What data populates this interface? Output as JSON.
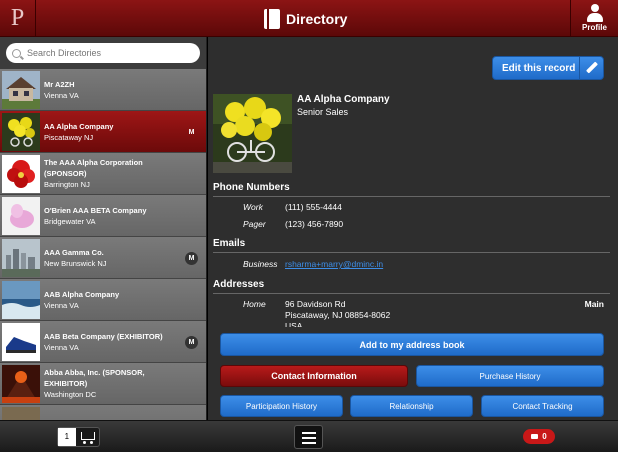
{
  "header": {
    "logo": "P",
    "title": "Directory",
    "title_icon": "address-book-icon",
    "profile_label": "Profile",
    "color": "#7a1010"
  },
  "sidebar": {
    "search_placeholder": "Search Directories",
    "items": [
      {
        "name": "Mr A2ZH",
        "location": "Vienna VA",
        "badge": "",
        "selected": false
      },
      {
        "name": "AA Alpha Company",
        "location": "Piscataway NJ",
        "badge": "M",
        "selected": true
      },
      {
        "name": "The AAA Alpha Corporation (SPONSOR)",
        "location": "Barrington NJ",
        "badge": "",
        "selected": false
      },
      {
        "name": "O'Brien AAA BETA Company",
        "location": "Bridgewater VA",
        "badge": "",
        "selected": false
      },
      {
        "name": "AAA Gamma Co.",
        "location": "New Brunswick NJ",
        "badge": "M",
        "selected": false
      },
      {
        "name": "AAB Alpha Company",
        "location": "Vienna VA",
        "badge": "",
        "selected": false
      },
      {
        "name": "AAB Beta Company (EXHIBITOR)",
        "location": "Vienna VA",
        "badge": "M",
        "selected": false
      },
      {
        "name": "Abba Abba, Inc. (SPONSOR, EXHIBITOR)",
        "location": "Washington DC",
        "badge": "",
        "selected": false
      },
      {
        "name": "",
        "location": "",
        "badge": "",
        "selected": false
      }
    ]
  },
  "detail": {
    "edit_label": "Edit this record",
    "company": "AA Alpha Company",
    "role": "Senior Sales",
    "phone_heading": "Phone Numbers",
    "phones": [
      {
        "label": "Work",
        "value": "(111) 555-4444"
      },
      {
        "label": "Pager",
        "value": "(123) 456-7890"
      }
    ],
    "email_heading": "Emails",
    "email": {
      "label": "Business",
      "value": "rsharma+marry@dminc.in"
    },
    "address_heading": "Addresses",
    "address": {
      "label": "Home",
      "line1": "96 Davidson Rd",
      "line2": "Piscataway, NJ 08854-8062",
      "line3": "USA",
      "tag": "Main"
    },
    "buttons": {
      "add_address_book": "Add to my address book",
      "contact_info": "Contact Information",
      "purchase_history": "Purchase History",
      "participation_history": "Participation History",
      "relationship": "Relationship",
      "contact_tracking": "Contact Tracking"
    }
  },
  "footer": {
    "cart_count": "1",
    "messages_count": "0"
  },
  "colors": {
    "accent_blue": "#2d7ddb",
    "accent_red": "#9e1616"
  }
}
